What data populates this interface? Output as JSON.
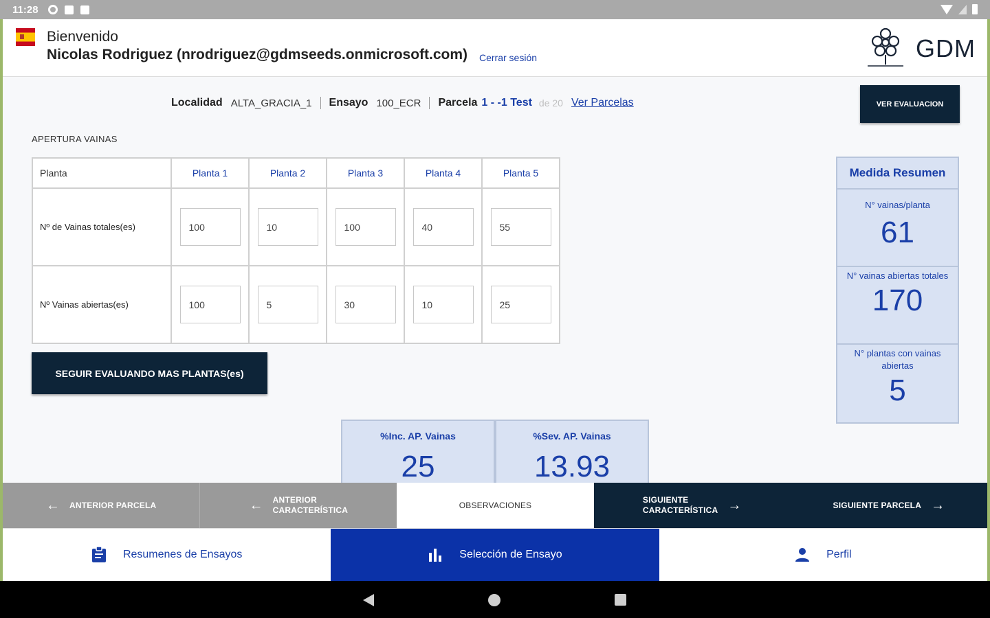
{
  "status_bar": {
    "time": "11:28"
  },
  "header": {
    "welcome": "Bienvenido",
    "user": "Nicolas Rodriguez (nrodriguez@gdmseeds.onmicrosoft.com)",
    "logout": "Cerrar sesión",
    "brand": "GDM"
  },
  "trial": {
    "locality_label": "Localidad",
    "locality_value": "ALTA_GRACIA_1",
    "trial_label": "Ensayo",
    "trial_value": "100_ECR",
    "plot_label": "Parcela",
    "plot_value": "1 - -1 Test",
    "plot_of": "de 20",
    "see_plots": "Ver Parcelas",
    "eval_button": "VER EVALUACION"
  },
  "section_title": "APERTURA VAINAS",
  "table": {
    "corner": "Planta",
    "columns": [
      "Planta 1",
      "Planta 2",
      "Planta 3",
      "Planta 4",
      "Planta 5"
    ],
    "rows": [
      {
        "label": "Nº de Vainas totales(es)",
        "values": [
          "100",
          "10",
          "100",
          "40",
          "55"
        ]
      },
      {
        "label": "Nº Vainas abiertas(es)",
        "values": [
          "100",
          "5",
          "30",
          "10",
          "25"
        ]
      }
    ]
  },
  "more_button": "SEGUIR EVALUANDO MAS PLANTAS(es)",
  "summary": {
    "title": "Medida Resumen",
    "items": [
      {
        "label": "N° vainas/planta",
        "value": "61"
      },
      {
        "label": "N° vainas abiertas totales",
        "value": "170"
      },
      {
        "label": "N° plantas con vainas abiertas",
        "value": "5"
      }
    ]
  },
  "percentages": [
    {
      "label": "%Inc. AP. Vainas",
      "value": "25"
    },
    {
      "label": "%Sev. AP. Vainas",
      "value": "13.93"
    }
  ],
  "nav": {
    "prev_plot": "ANTERIOR PARCELA",
    "prev_char_1": "ANTERIOR",
    "prev_char_2": "CARACTERÍSTICA",
    "observations": "OBSERVACIONES",
    "next_char_1": "SIGUIENTE",
    "next_char_2": "CARACTERÍSTICA",
    "next_plot": "SIGUIENTE PARCELA"
  },
  "tabs": [
    {
      "label": "Resumenes de Ensayos",
      "icon": "clipboard-icon"
    },
    {
      "label": "Selección de Ensayo",
      "icon": "bar-chart-icon",
      "active": true
    },
    {
      "label": "Perfil",
      "icon": "person-icon"
    }
  ],
  "colors": {
    "dark": "#0d2438",
    "accent": "#1a3fa8",
    "active_tab": "#0b32a8",
    "summary_bg": "#d9e2f3",
    "nav_gray": "#9a9a9a"
  }
}
